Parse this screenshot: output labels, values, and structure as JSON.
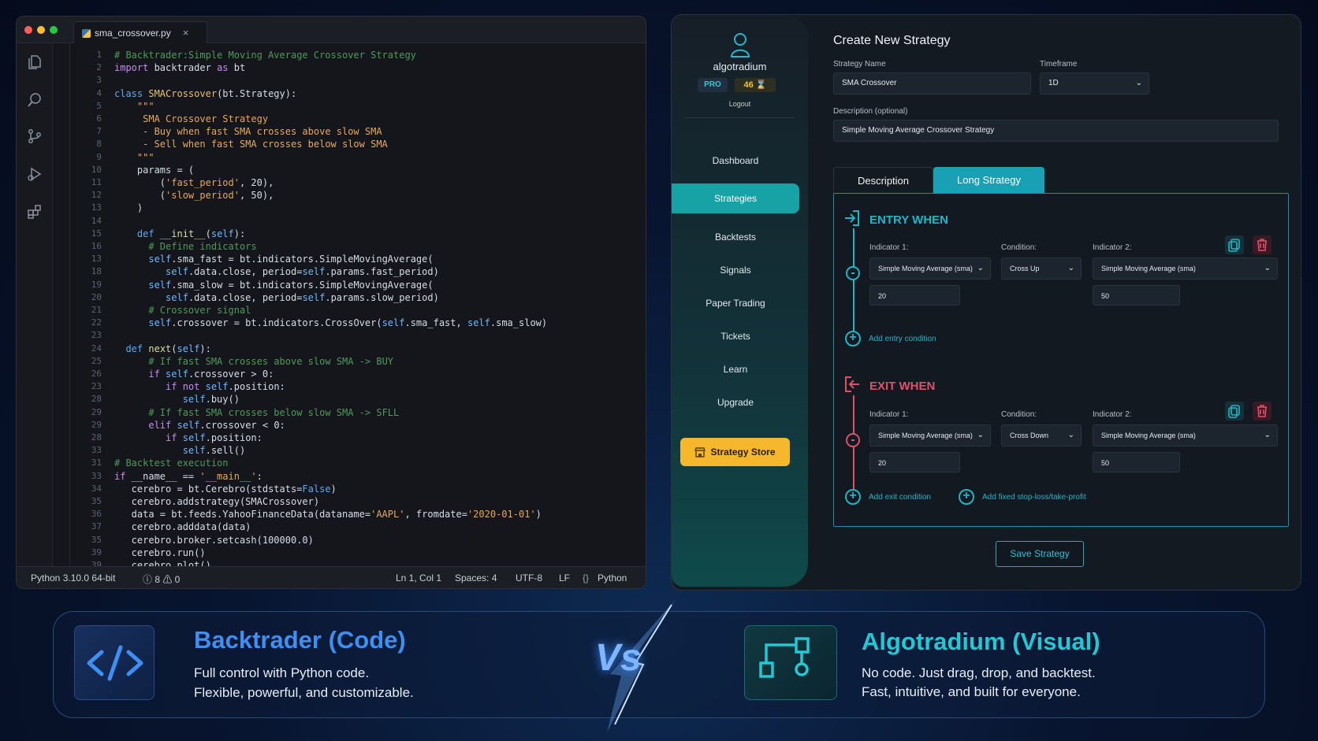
{
  "editor": {
    "tab_name": "sma_crossover.py",
    "code_lines": [
      {
        "n": "1",
        "html": "<span class='cm'># Backtrader:Simple Moving Average Crossover Strategy</span>"
      },
      {
        "n": "2",
        "html": "<span class='kw'>import</span> backtrader <span class='kw'>as</span> bt"
      },
      {
        "n": "3",
        "html": ""
      },
      {
        "n": "4",
        "html": "<span class='kw2'>class</span> <span class='nm'>SMACrossover</span>(bt.Strategy):"
      },
      {
        "n": "5",
        "html": "    <span class='st'>\"\"\"</span>"
      },
      {
        "n": "6",
        "html": "     <span class='st'>SMA Crossover Strategy</span>"
      },
      {
        "n": "7",
        "html": "     <span class='st'>- Buy when fast SMA crosses above slow SMA</span>"
      },
      {
        "n": "8",
        "html": "     <span class='st'>- Sell when fast SMA crosses below slow SMA</span>"
      },
      {
        "n": "9",
        "html": "    <span class='st'>\"\"\"</span>"
      },
      {
        "n": "10",
        "html": "    params = ("
      },
      {
        "n": "11",
        "html": "        (<span class='st'>'fast_period'</span>, 20),"
      },
      {
        "n": "12",
        "html": "        (<span class='st'>'slow_period'</span>, 50),"
      },
      {
        "n": "13",
        "html": "    )"
      },
      {
        "n": "14",
        "html": ""
      },
      {
        "n": "15",
        "html": "    <span class='kw2'>def</span> <span class='fn'>__init__</span>(<span class='sl'>self</span>):"
      },
      {
        "n": "16",
        "html": "      <span class='cm'># Define indicators</span>"
      },
      {
        "n": "13",
        "html": "      <span class='sl'>self</span>.sma_fast = bt.indicators.SimpleMovingAverage("
      },
      {
        "n": "18",
        "html": "         <span class='sl'>self</span>.data.close, period=<span class='sl'>self</span>.params.fast_period)"
      },
      {
        "n": "19",
        "html": "      <span class='sl'>self</span>.sma_slow = bt.indicators.SimpleMovingAverage("
      },
      {
        "n": "20",
        "html": "         <span class='sl'>self</span>.data.close, period=<span class='sl'>self</span>.params.slow_period)"
      },
      {
        "n": "21",
        "html": "      <span class='cm'># Crossover signal</span>"
      },
      {
        "n": "22",
        "html": "      <span class='sl'>self</span>.crossover = bt.indicators.CrossOver(<span class='sl'>self</span>.sma_fast, <span class='sl'>self</span>.sma_slow)"
      },
      {
        "n": "23",
        "html": ""
      },
      {
        "n": "24",
        "html": "  <span class='kw2'>def</span> <span class='fn'>next</span>(<span class='sl'>self</span>):"
      },
      {
        "n": "25",
        "html": "      <span class='cm'># If fast SMA crosses above slow SMA -> BUY</span>"
      },
      {
        "n": "26",
        "html": "      <span class='kw'>if</span> <span class='sl'>self</span>.crossover &gt; 0:"
      },
      {
        "n": "23",
        "html": "         <span class='kw'>if not</span> <span class='sl'>self</span>.position:"
      },
      {
        "n": "28",
        "html": "            <span class='sl'>self</span>.buy()"
      },
      {
        "n": "29",
        "html": "      <span class='cm'># If fast SMA crosses below slow SMA -> SFLL</span>"
      },
      {
        "n": "29",
        "html": "      <span class='kw'>elif</span> <span class='sl'>self</span>.crossover &lt; 0:"
      },
      {
        "n": "28",
        "html": "         <span class='kw'>if</span> <span class='sl'>self</span>.position:"
      },
      {
        "n": "33",
        "html": "            <span class='sl'>self</span>.sell()"
      },
      {
        "n": "31",
        "html": "<span class='cm'># Backtest execution</span>"
      },
      {
        "n": "33",
        "html": "<span class='kw'>if</span> __name__ == <span class='st'>'__main__'</span>:"
      },
      {
        "n": "34",
        "html": "   cerebro = bt.Cerebro(stdstats=<span class='kw2'>False</span>)"
      },
      {
        "n": "35",
        "html": "   cerebro.addstrategy(SMACrossover)"
      },
      {
        "n": "36",
        "html": "   data = bt.feeds.YahooFinanceData(dataname=<span class='st'>'AAPL'</span>, fromdate=<span class='st'>'2020-01-01'</span>)"
      },
      {
        "n": "37",
        "html": "   cerebro.adddata(data)"
      },
      {
        "n": "35",
        "html": "   cerebro.broker.setcash(100000.0)"
      },
      {
        "n": "39",
        "html": "   cerebro.run()"
      },
      {
        "n": "39",
        "html": "   cerebro.plot()"
      }
    ],
    "status": {
      "python": "Python  3.10.0 64-bit",
      "problems": "ⓘ 8 ⚠ 0",
      "position": "Ln 1, Col 1",
      "spaces": "Spaces: 4",
      "encoding": "UTF-8",
      "eol": "LF",
      "language": "Python"
    }
  },
  "app": {
    "brand": "algotradium",
    "pro": "PRO",
    "credits": "46 ⌛",
    "logout": "Logout",
    "nav": [
      "Dashboard",
      "Strategies",
      "Backtests",
      "Signals",
      "Paper Trading",
      "Tickets",
      "Learn",
      "Upgrade"
    ],
    "active_nav": "Strategies",
    "store": "Strategy Store",
    "title": "Create New Strategy",
    "strategy_name_label": "Strategy Name",
    "strategy_name_value": "SMA Crossover",
    "timeframe_label": "Timeframe",
    "timeframe_value": "1D",
    "description_label": "Description (optional)",
    "description_value": "Simple Moving Average Crossover Strategy",
    "tab_description": "Description",
    "tab_long": "Long Strategy",
    "entry": {
      "title": "ENTRY WHEN",
      "indicator1_label": "Indicator 1:",
      "condition_label": "Condition:",
      "indicator2_label": "Indicator 2:",
      "indicator1": "Simple Moving Average (sma)",
      "condition": "Cross Up",
      "indicator2": "Simple Moving Average (sma)",
      "period1": "20",
      "period2": "50",
      "add": "Add entry condition"
    },
    "exit": {
      "title": "EXIT WHEN",
      "indicator1_label": "Indicator 1:",
      "condition_label": "Condition:",
      "indicator2_label": "Indicator 2:",
      "indicator1": "Simple Moving Average (sma)",
      "condition": "Cross Down",
      "indicator2": "Simple Moving Average (sma)",
      "period1": "20",
      "period2": "50",
      "add": "Add exit condition",
      "add_fixed": "Add fixed stop-loss/take-profit"
    },
    "save": "Save Strategy"
  },
  "compare": {
    "left_title": "Backtrader (Code)",
    "left_line1": "Full control with Python code.",
    "left_line2": "Flexible, powerful, and customizable.",
    "vs": "Vs",
    "right_title": "Algotradium (Visual)",
    "right_line1": "No code. Just drag, drop, and backtest.",
    "right_line2": "Fast, intuitive, and built for everyone."
  },
  "colors": {
    "accent_teal": "#17a2a5",
    "entry_color": "#1fb6c8",
    "exit_color": "#e0506a",
    "store_yellow": "#f5b72b",
    "left_title_blue": "#3d8ff2",
    "right_title_teal": "#22c8d4"
  }
}
